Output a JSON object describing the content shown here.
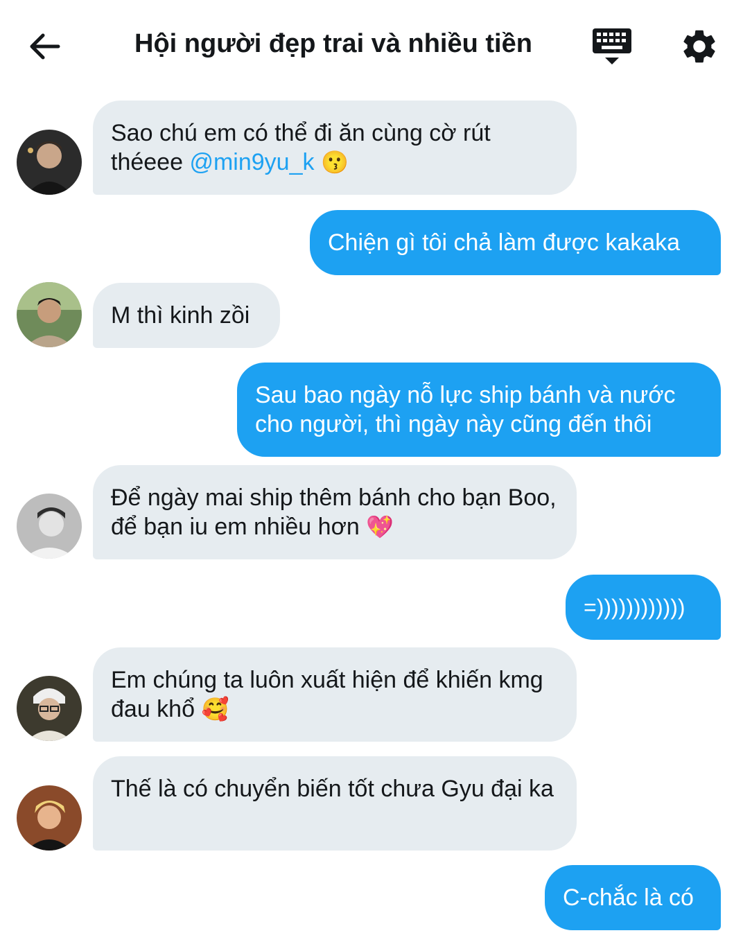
{
  "header": {
    "title": "Hội người đẹp trai và nhiều tiền",
    "back_icon": "back-arrow-icon",
    "keyboard_icon": "keyboard-icon",
    "settings_icon": "gear-icon"
  },
  "colors": {
    "incoming_bubble": "#e6ecf0",
    "outgoing_bubble": "#1da1f2",
    "mention": "#1da1f2"
  },
  "messages": [
    {
      "direction": "in",
      "text": "Sao chú em có thể đi ăn cùng cờ rút théeee ",
      "mention": "@min9yu_k",
      "emoji": "😗"
    },
    {
      "direction": "out",
      "text": "Chiện gì tôi chả làm được kakaka"
    },
    {
      "direction": "in",
      "text": "M thì kinh zồi"
    },
    {
      "direction": "out",
      "text": "Sau bao ngày nỗ lực ship bánh và nước cho người, thì ngày này cũng đến thôi"
    },
    {
      "direction": "in",
      "text": "Để ngày mai ship thêm bánh cho bạn Boo, để bạn iu em nhiều hơn ",
      "emoji": "💖"
    },
    {
      "direction": "out",
      "text": "=))))))))))))"
    },
    {
      "direction": "in",
      "text": "Em chúng ta luôn xuất hiện để khiến kmg đau khổ ",
      "emoji": "🥰"
    },
    {
      "direction": "in",
      "text": "Thế là có chuyển biến tốt chưa Gyu đại ka"
    },
    {
      "direction": "out",
      "text": "C-chắc là có"
    }
  ]
}
